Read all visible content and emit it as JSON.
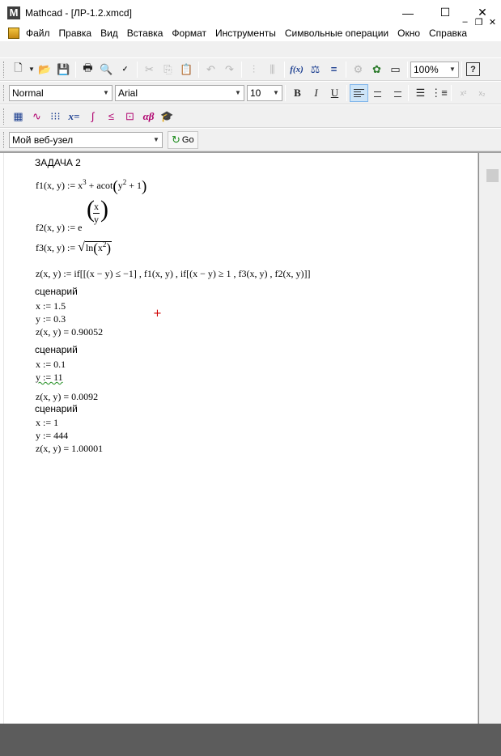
{
  "window": {
    "app_logo": "M",
    "title": "Mathcad - [ЛР-1.2.xmcd]",
    "minimize_glyph": "—",
    "maximize_glyph": "☐",
    "close_glyph": "✕"
  },
  "menu": {
    "items": [
      "Файл",
      "Правка",
      "Вид",
      "Вставка",
      "Формат",
      "Инструменты",
      "Символьные операции",
      "Окно",
      "Справка"
    ],
    "mdi_minimize": "–",
    "mdi_restore": "❐",
    "mdi_close": "✕"
  },
  "toolbar_standard": {
    "icons": [
      "new-document-icon",
      "open-folder-icon",
      "save-icon",
      "print-icon",
      "print-preview-icon",
      "spell-check-icon",
      "cut-icon",
      "copy-icon",
      "paste-icon",
      "undo-icon",
      "redo-icon",
      "align-across-icon",
      "align-down-icon",
      "insert-function-icon",
      "insert-unit-icon",
      "calculate-icon",
      "component-icon",
      "resource-center-icon",
      "insert-region-icon",
      "help-icon"
    ],
    "zoom_value": "100%"
  },
  "toolbar_formatting": {
    "style_value": "Normal",
    "font_value": "Arial",
    "size_value": "10",
    "bold_label": "B",
    "italic_label": "I",
    "underline_label": "U",
    "superscript_label": "x²",
    "subscript_label": "x₂"
  },
  "toolbar_math": {
    "icons": [
      "calculator-icon",
      "graph-icon",
      "matrix-icon",
      "evaluation-icon",
      "calculus-icon",
      "boolean-icon",
      "programming-icon",
      "greek-icon",
      "symbolic-icon"
    ],
    "labels": {
      "eval": "x=",
      "greek": "αβ"
    }
  },
  "toolbar_web": {
    "address_value": "Мой веб-узел",
    "go_label": "Go"
  },
  "worksheet": {
    "task_title": "ЗАДАЧА 2",
    "f1": {
      "lhs": "f1(x, y) := x",
      "exp": "3",
      "rhs_a": " + acot",
      "rhs_b": "y",
      "rhs_exp": "2",
      "rhs_c": " + 1"
    },
    "f2": {
      "lhs": "f2(x, y) := e",
      "num": "x",
      "den": "y"
    },
    "f3": {
      "lhs": "f3(x, y) := ",
      "ln": "ln",
      "arg": "x",
      "exp": "2"
    },
    "z_def": "z(x, y) := if[[(x − y) ≤ −1] , f1(x, y) , if[(x − y) ≥ 1 , f3(x, y) , f2(x, y)]]",
    "scenarios": [
      {
        "label": "сценарий",
        "x": "x := 1.5",
        "y": "y := 0.3",
        "result": "z(x, y) = 0.90052"
      },
      {
        "label": "сценарий",
        "x": "x := 0.1",
        "y": "y := 11",
        "result": "z(x, y) = 0.0092"
      },
      {
        "label": "сценарий",
        "x": "x := 1",
        "y": "y := 444",
        "result": "z(x, y) = 1.00001"
      }
    ]
  }
}
